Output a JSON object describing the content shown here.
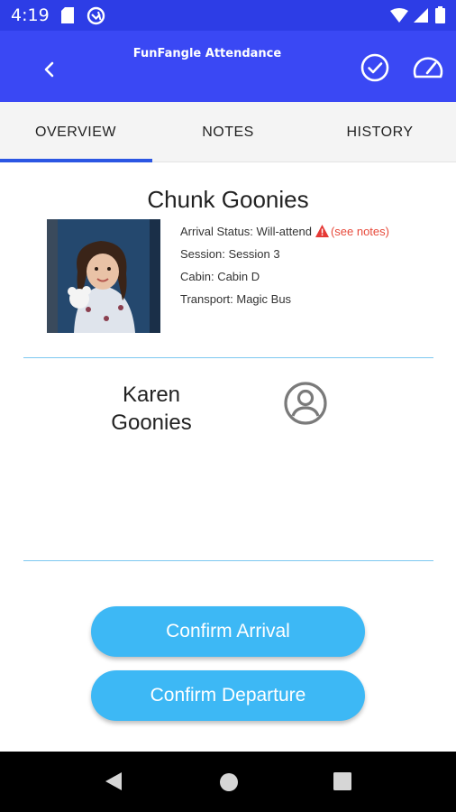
{
  "status_bar": {
    "time": "4:19",
    "icons": [
      "sd-card-icon",
      "sync-icon",
      "wifi-icon",
      "signal-icon",
      "battery-icon"
    ]
  },
  "app_bar": {
    "title": "FunFangle Attendance",
    "icons": [
      "back-arrow-icon",
      "check-circle-icon",
      "gauge-icon"
    ]
  },
  "tabs": [
    {
      "label": "OVERVIEW",
      "active": true
    },
    {
      "label": "NOTES",
      "active": false
    },
    {
      "label": "HISTORY",
      "active": false
    }
  ],
  "camper": {
    "name": "Chunk Goonies",
    "arrival_status": "Arrival Status: Will-attend",
    "see_notes": "(see notes)",
    "session": "Session: Session 3",
    "cabin": "Cabin: Cabin D",
    "transport": "Transport: Magic Bus"
  },
  "guardian": {
    "name": "Karen Goonies",
    "icon": "account-circle-icon"
  },
  "actions": {
    "confirm_arrival": "Confirm Arrival",
    "confirm_departure": "Confirm Departure"
  },
  "colors": {
    "status_bar": "#2d3de6",
    "app_bar": "#3a48f4",
    "tab_indicator": "#2b56e3",
    "button": "#3db8f5",
    "warning": "#e53935",
    "see_notes": "#e74a3b",
    "divider": "#7cc8f0"
  }
}
